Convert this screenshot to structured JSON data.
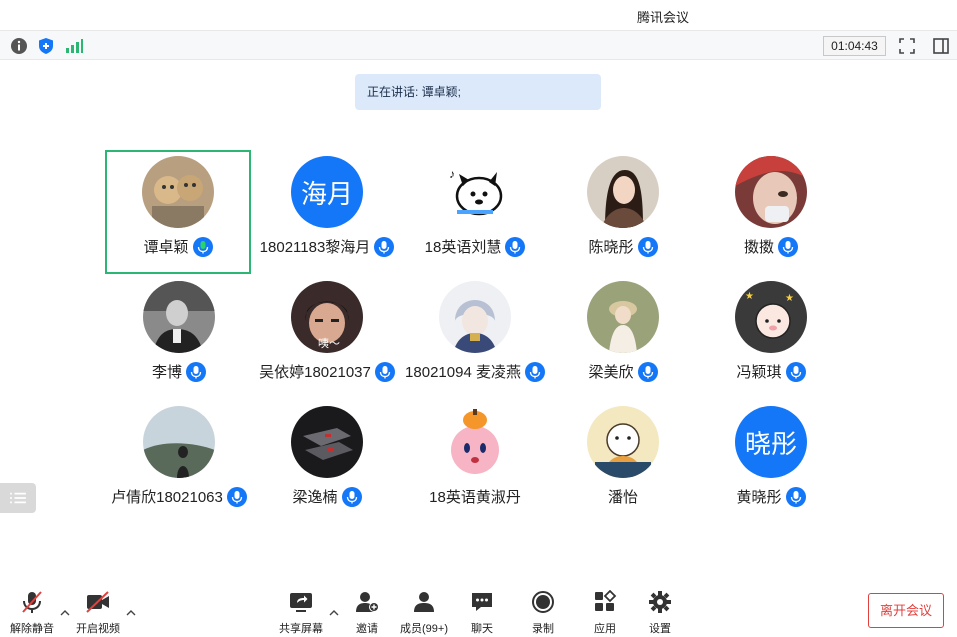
{
  "window": {
    "title": "腾讯会议"
  },
  "infobar": {
    "timer": "01:04:43"
  },
  "speaking": {
    "text": "正在讲话: 谭卓颖;"
  },
  "participants": [
    {
      "name": "谭卓颖",
      "avatar": "photo",
      "mic": true,
      "active": true
    },
    {
      "name": "18021183黎海月",
      "avatar_text": "海月",
      "mic": true
    },
    {
      "name": "18英语刘慧",
      "avatar": "cartoon-dog",
      "mic": true
    },
    {
      "name": "陈晓彤",
      "avatar": "photo",
      "mic": true
    },
    {
      "name": "擞擞",
      "avatar": "photo",
      "mic": true
    },
    {
      "name": "李博",
      "avatar": "photo",
      "mic": true
    },
    {
      "name": "吴依婷18021037",
      "avatar": "photo",
      "mic": true
    },
    {
      "name": "18021094 麦凌燕",
      "avatar": "anime",
      "mic": true
    },
    {
      "name": "梁美欣",
      "avatar": "photo",
      "mic": true
    },
    {
      "name": "冯颖琪",
      "avatar": "cartoon",
      "mic": true
    },
    {
      "name": "卢倩欣18021063",
      "avatar": "photo",
      "mic": true
    },
    {
      "name": "梁逸楠",
      "avatar": "photo",
      "mic": true
    },
    {
      "name": "18英语黄淑丹",
      "avatar": "cartoon-kirby",
      "mic": false
    },
    {
      "name": "潘怡",
      "avatar": "cartoon-bear",
      "mic": false
    },
    {
      "name": "黄晓彤",
      "avatar_text": "晓彤",
      "mic": true
    }
  ],
  "toolbar": {
    "unmute": "解除静音",
    "start_video": "开启视频",
    "share_screen": "共享屏幕",
    "invite": "邀请",
    "members": "成员(99+)",
    "chat": "聊天",
    "record": "录制",
    "apps": "应用",
    "settings": "设置",
    "leave": "离开会议"
  },
  "colors": {
    "accent": "#1477f7",
    "active_border": "#2bb673",
    "leave": "#e0413e",
    "speaking_bg": "#dbe9fb"
  }
}
